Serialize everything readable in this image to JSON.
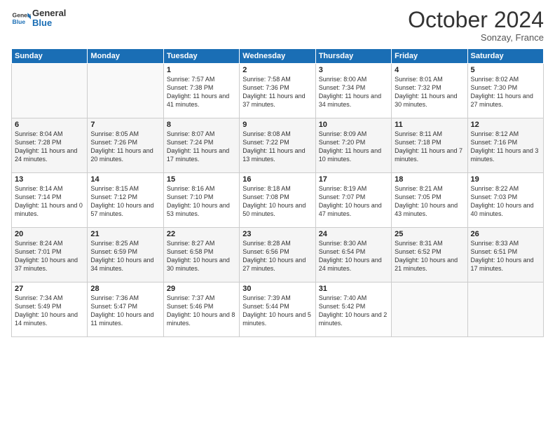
{
  "logo": {
    "line1": "General",
    "line2": "Blue"
  },
  "title": "October 2024",
  "subtitle": "Sonzay, France",
  "headers": [
    "Sunday",
    "Monday",
    "Tuesday",
    "Wednesday",
    "Thursday",
    "Friday",
    "Saturday"
  ],
  "weeks": [
    [
      {
        "day": "",
        "text": ""
      },
      {
        "day": "",
        "text": ""
      },
      {
        "day": "1",
        "text": "Sunrise: 7:57 AM\nSunset: 7:38 PM\nDaylight: 11 hours and 41 minutes."
      },
      {
        "day": "2",
        "text": "Sunrise: 7:58 AM\nSunset: 7:36 PM\nDaylight: 11 hours and 37 minutes."
      },
      {
        "day": "3",
        "text": "Sunrise: 8:00 AM\nSunset: 7:34 PM\nDaylight: 11 hours and 34 minutes."
      },
      {
        "day": "4",
        "text": "Sunrise: 8:01 AM\nSunset: 7:32 PM\nDaylight: 11 hours and 30 minutes."
      },
      {
        "day": "5",
        "text": "Sunrise: 8:02 AM\nSunset: 7:30 PM\nDaylight: 11 hours and 27 minutes."
      }
    ],
    [
      {
        "day": "6",
        "text": "Sunrise: 8:04 AM\nSunset: 7:28 PM\nDaylight: 11 hours and 24 minutes."
      },
      {
        "day": "7",
        "text": "Sunrise: 8:05 AM\nSunset: 7:26 PM\nDaylight: 11 hours and 20 minutes."
      },
      {
        "day": "8",
        "text": "Sunrise: 8:07 AM\nSunset: 7:24 PM\nDaylight: 11 hours and 17 minutes."
      },
      {
        "day": "9",
        "text": "Sunrise: 8:08 AM\nSunset: 7:22 PM\nDaylight: 11 hours and 13 minutes."
      },
      {
        "day": "10",
        "text": "Sunrise: 8:09 AM\nSunset: 7:20 PM\nDaylight: 11 hours and 10 minutes."
      },
      {
        "day": "11",
        "text": "Sunrise: 8:11 AM\nSunset: 7:18 PM\nDaylight: 11 hours and 7 minutes."
      },
      {
        "day": "12",
        "text": "Sunrise: 8:12 AM\nSunset: 7:16 PM\nDaylight: 11 hours and 3 minutes."
      }
    ],
    [
      {
        "day": "13",
        "text": "Sunrise: 8:14 AM\nSunset: 7:14 PM\nDaylight: 11 hours and 0 minutes."
      },
      {
        "day": "14",
        "text": "Sunrise: 8:15 AM\nSunset: 7:12 PM\nDaylight: 10 hours and 57 minutes."
      },
      {
        "day": "15",
        "text": "Sunrise: 8:16 AM\nSunset: 7:10 PM\nDaylight: 10 hours and 53 minutes."
      },
      {
        "day": "16",
        "text": "Sunrise: 8:18 AM\nSunset: 7:08 PM\nDaylight: 10 hours and 50 minutes."
      },
      {
        "day": "17",
        "text": "Sunrise: 8:19 AM\nSunset: 7:07 PM\nDaylight: 10 hours and 47 minutes."
      },
      {
        "day": "18",
        "text": "Sunrise: 8:21 AM\nSunset: 7:05 PM\nDaylight: 10 hours and 43 minutes."
      },
      {
        "day": "19",
        "text": "Sunrise: 8:22 AM\nSunset: 7:03 PM\nDaylight: 10 hours and 40 minutes."
      }
    ],
    [
      {
        "day": "20",
        "text": "Sunrise: 8:24 AM\nSunset: 7:01 PM\nDaylight: 10 hours and 37 minutes."
      },
      {
        "day": "21",
        "text": "Sunrise: 8:25 AM\nSunset: 6:59 PM\nDaylight: 10 hours and 34 minutes."
      },
      {
        "day": "22",
        "text": "Sunrise: 8:27 AM\nSunset: 6:58 PM\nDaylight: 10 hours and 30 minutes."
      },
      {
        "day": "23",
        "text": "Sunrise: 8:28 AM\nSunset: 6:56 PM\nDaylight: 10 hours and 27 minutes."
      },
      {
        "day": "24",
        "text": "Sunrise: 8:30 AM\nSunset: 6:54 PM\nDaylight: 10 hours and 24 minutes."
      },
      {
        "day": "25",
        "text": "Sunrise: 8:31 AM\nSunset: 6:52 PM\nDaylight: 10 hours and 21 minutes."
      },
      {
        "day": "26",
        "text": "Sunrise: 8:33 AM\nSunset: 6:51 PM\nDaylight: 10 hours and 17 minutes."
      }
    ],
    [
      {
        "day": "27",
        "text": "Sunrise: 7:34 AM\nSunset: 5:49 PM\nDaylight: 10 hours and 14 minutes."
      },
      {
        "day": "28",
        "text": "Sunrise: 7:36 AM\nSunset: 5:47 PM\nDaylight: 10 hours and 11 minutes."
      },
      {
        "day": "29",
        "text": "Sunrise: 7:37 AM\nSunset: 5:46 PM\nDaylight: 10 hours and 8 minutes."
      },
      {
        "day": "30",
        "text": "Sunrise: 7:39 AM\nSunset: 5:44 PM\nDaylight: 10 hours and 5 minutes."
      },
      {
        "day": "31",
        "text": "Sunrise: 7:40 AM\nSunset: 5:42 PM\nDaylight: 10 hours and 2 minutes."
      },
      {
        "day": "",
        "text": ""
      },
      {
        "day": "",
        "text": ""
      }
    ]
  ]
}
